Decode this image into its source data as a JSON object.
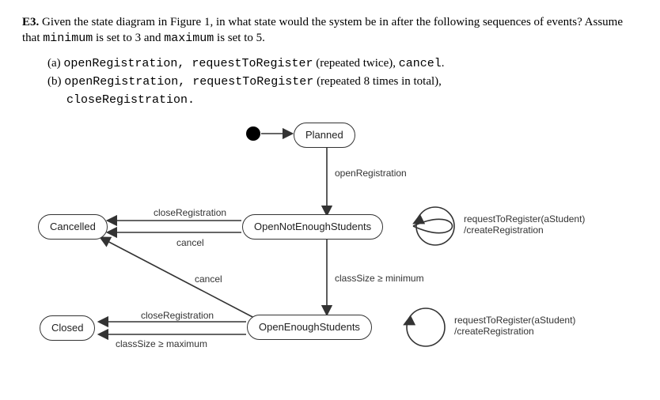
{
  "question": {
    "tag": "E3.",
    "prompt_a": " Given the state diagram in Figure 1, in what state would the system be in after the following sequences of events? Assume that ",
    "min_name": "minimum",
    "mid_text": " is set to 3 and ",
    "max_name": "maximum",
    "tail_text": " is set to 5."
  },
  "parts": {
    "a": {
      "label": "(a) ",
      "seq1": "openRegistration, requestToRegister",
      "seq1_tail": " (repeated twice), ",
      "seq1_last": "cancel",
      "seq1_dot": "."
    },
    "b": {
      "label": "(b) ",
      "seq1": "openRegistration, requestToRegister",
      "seq1_tail": " (repeated 8 times in total),",
      "line2": "closeRegistration."
    }
  },
  "states": {
    "planned": "Planned",
    "cancelled": "Cancelled",
    "ones": "OpenNotEnoughStudents",
    "oes": "OpenEnoughStudents",
    "closed": "Closed"
  },
  "transitions": {
    "openRegistration": "openRegistration",
    "closeRegistration1": "closeRegistration",
    "cancel1": "cancel",
    "cancel2": "cancel",
    "classSizeMin": "classSize ≥ minimum",
    "closeRegistration2": "closeRegistration",
    "classSizeMax": "classSize ≥ maximum",
    "loop1a": "requestToRegister(aStudent)",
    "loop1b": "/createRegistration",
    "loop2a": "requestToRegister(aStudent)",
    "loop2b": "/createRegistration"
  },
  "chart_data": {
    "type": "state_diagram",
    "parameters": {
      "minimum": 3,
      "maximum": 5
    },
    "initial_state": "Planned",
    "states": [
      "Planned",
      "OpenNotEnoughStudents",
      "OpenEnoughStudents",
      "Cancelled",
      "Closed"
    ],
    "transitions": [
      {
        "from": "initial",
        "to": "Planned",
        "trigger": ""
      },
      {
        "from": "Planned",
        "to": "OpenNotEnoughStudents",
        "trigger": "openRegistration"
      },
      {
        "from": "OpenNotEnoughStudents",
        "to": "OpenNotEnoughStudents",
        "trigger": "requestToRegister(aStudent)",
        "action": "createRegistration"
      },
      {
        "from": "OpenNotEnoughStudents",
        "to": "Cancelled",
        "trigger": "closeRegistration"
      },
      {
        "from": "OpenNotEnoughStudents",
        "to": "Cancelled",
        "trigger": "cancel"
      },
      {
        "from": "OpenNotEnoughStudents",
        "to": "OpenEnoughStudents",
        "guard": "classSize ≥ minimum"
      },
      {
        "from": "OpenEnoughStudents",
        "to": "OpenEnoughStudents",
        "trigger": "requestToRegister(aStudent)",
        "action": "createRegistration"
      },
      {
        "from": "OpenEnoughStudents",
        "to": "Cancelled",
        "trigger": "cancel"
      },
      {
        "from": "OpenEnoughStudents",
        "to": "Closed",
        "trigger": "closeRegistration"
      },
      {
        "from": "OpenEnoughStudents",
        "to": "Closed",
        "guard": "classSize ≥ maximum"
      }
    ]
  }
}
